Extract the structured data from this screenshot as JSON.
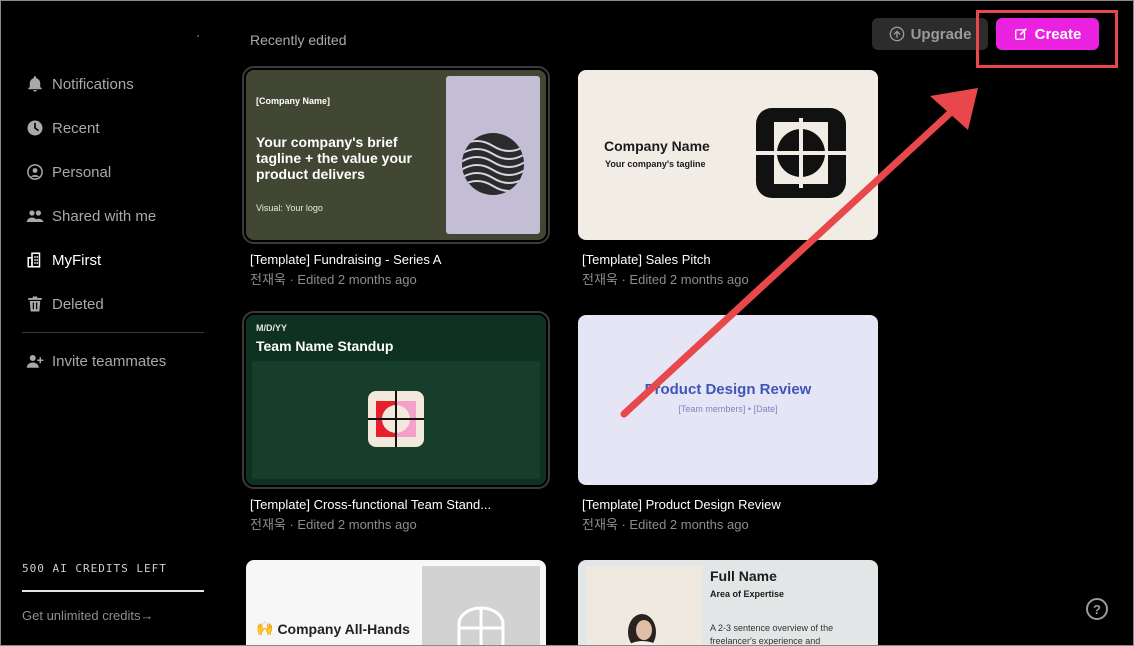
{
  "sidebar": {
    "items": [
      {
        "label": "Notifications",
        "icon": "bell-icon",
        "active": false
      },
      {
        "label": "Recent",
        "icon": "clock-icon",
        "active": false
      },
      {
        "label": "Personal",
        "icon": "user-circle-icon",
        "active": false
      },
      {
        "label": "Shared with me",
        "icon": "users-icon",
        "active": false
      },
      {
        "label": "MyFirst",
        "icon": "building-icon",
        "active": true
      },
      {
        "label": "Deleted",
        "icon": "trash-icon",
        "active": false
      }
    ],
    "invite_label": "Invite teammates",
    "credits_text": "500 AI CREDITS LEFT",
    "unlimited_text": "Get unlimited credits→"
  },
  "header": {
    "section_title": "Recently edited",
    "upgrade_label": "Upgrade",
    "create_label": "Create"
  },
  "colors": {
    "create_accent": "#ea22e0",
    "annotation": "#e8474b"
  },
  "cards": [
    {
      "title": "[Template] Fundraising - Series A",
      "meta": "전재욱 · Edited 2 months ago",
      "thumb": {
        "company": "[Company Name]",
        "tagline": "Your company's brief tagline + the value your product delivers",
        "visual": "Visual: Your logo"
      }
    },
    {
      "title": "[Template] Sales Pitch",
      "meta": "전재욱 · Edited 2 months ago",
      "thumb": {
        "name": "Company Name",
        "tagline": "Your company's tagline"
      }
    },
    {
      "title": "[Template] Cross-functional Team Stand...",
      "meta": "전재욱 · Edited 2 months ago",
      "thumb": {
        "date": "M/D/YY",
        "heading": "Team Name Standup"
      }
    },
    {
      "title": "[Template] Product Design Review",
      "meta": "전재욱 · Edited 2 months ago",
      "thumb": {
        "heading": "Product Design Review",
        "members": "[Team members] • [Date]"
      }
    },
    {
      "thumb": {
        "heading": "Company All-Hands"
      }
    },
    {
      "thumb": {
        "name": "Full Name",
        "area": "Area of Expertise",
        "desc": "A 2-3 sentence overview of the freelancer's experience and"
      }
    }
  ],
  "help_label": "?"
}
